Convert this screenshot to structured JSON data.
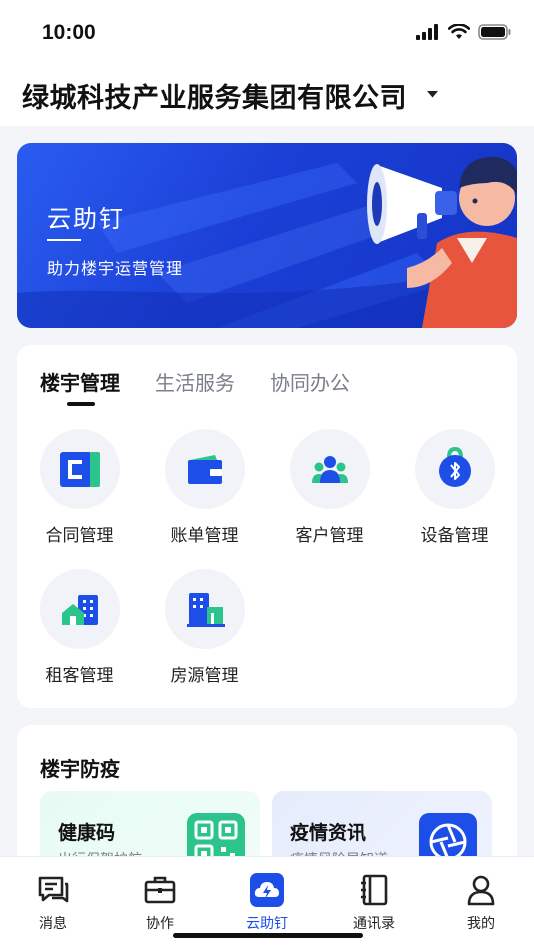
{
  "status": {
    "time": "10:00"
  },
  "header": {
    "org_name": "绿城科技产业服务集团有限公司"
  },
  "banner": {
    "title": "云助钉",
    "subtitle": "助力楼宇运营管理"
  },
  "main_card": {
    "tabs": [
      {
        "label": "楼宇管理",
        "active": true
      },
      {
        "label": "生活服务",
        "active": false
      },
      {
        "label": "协同办公",
        "active": false
      }
    ],
    "items": [
      {
        "label": "合同管理",
        "icon": "contract-icon"
      },
      {
        "label": "账单管理",
        "icon": "wallet-icon"
      },
      {
        "label": "客户管理",
        "icon": "customers-icon"
      },
      {
        "label": "设备管理",
        "icon": "bluetooth-device-icon"
      },
      {
        "label": "租客管理",
        "icon": "tenant-house-icon"
      },
      {
        "label": "房源管理",
        "icon": "building-icon"
      }
    ]
  },
  "epidemic_card": {
    "title": "楼宇防疫",
    "cards": [
      {
        "title": "健康码",
        "subtitle": "出行保驾护航",
        "icon": "qr-code-icon"
      },
      {
        "title": "疫情资讯",
        "subtitle": "疫情风险早知道",
        "icon": "shutter-icon"
      }
    ]
  },
  "bottom_nav": [
    {
      "label": "消息",
      "icon": "message-icon",
      "active": false
    },
    {
      "label": "协作",
      "icon": "briefcase-icon",
      "active": false
    },
    {
      "label": "云助钉",
      "icon": "cloud-bolt-icon",
      "active": true
    },
    {
      "label": "通讯录",
      "icon": "contacts-book-icon",
      "active": false
    },
    {
      "label": "我的",
      "icon": "profile-icon",
      "active": false
    }
  ],
  "colors": {
    "accent": "#1d4fe8",
    "banner": "#1b3fd6",
    "green": "#2bc48a"
  }
}
